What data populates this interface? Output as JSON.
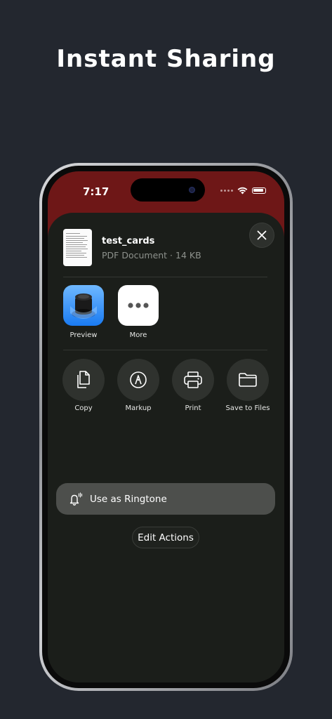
{
  "promo": {
    "headline": "Instant Sharing"
  },
  "status_bar": {
    "time": "7:17"
  },
  "share_sheet": {
    "file": {
      "name": "test_cards",
      "meta": "PDF Document · 14 KB"
    },
    "apps": [
      {
        "label": "Preview",
        "icon": "preview-icon"
      },
      {
        "label": "More",
        "icon": "more-icon"
      }
    ],
    "actions": [
      {
        "label": "Copy",
        "icon": "copy-icon"
      },
      {
        "label": "Markup",
        "icon": "markup-icon"
      },
      {
        "label": "Print",
        "icon": "printer-icon"
      },
      {
        "label": "Save to Files",
        "icon": "folder-icon"
      }
    ],
    "ringtone_label": "Use as Ringtone",
    "edit_actions_label": "Edit Actions"
  },
  "colors": {
    "page_background": "#23272f",
    "sheet_background": "#1b1e1a",
    "app_header": "#6e1717",
    "row_highlight": "#4d4f4c"
  }
}
